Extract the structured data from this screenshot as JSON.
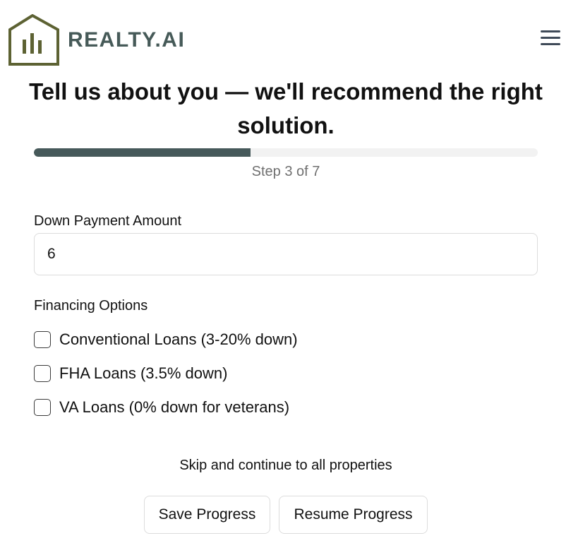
{
  "header": {
    "brand": "REALTY.AI",
    "logo_icon": "house-chart-icon",
    "menu_icon": "hamburger-menu-icon",
    "logo_color": "#5d6233",
    "brand_color": "#465a58"
  },
  "title": "Tell us about you — we'll recommend the right solution.",
  "progress": {
    "current_step": 3,
    "total_steps": 7,
    "fraction": 0.43,
    "label": "Step 3 of 7",
    "fill_color": "#46595a"
  },
  "down_payment": {
    "label": "Down Payment Amount",
    "value": "6"
  },
  "financing": {
    "label": "Financing Options",
    "options": [
      {
        "label": "Conventional Loans (3-20% down)",
        "checked": false
      },
      {
        "label": "FHA Loans (3.5% down)",
        "checked": false
      },
      {
        "label": "VA Loans (0% down for veterans)",
        "checked": false
      }
    ]
  },
  "skip_link": "Skip and continue to all properties",
  "buttons": {
    "save": "Save Progress",
    "resume": "Resume Progress"
  }
}
